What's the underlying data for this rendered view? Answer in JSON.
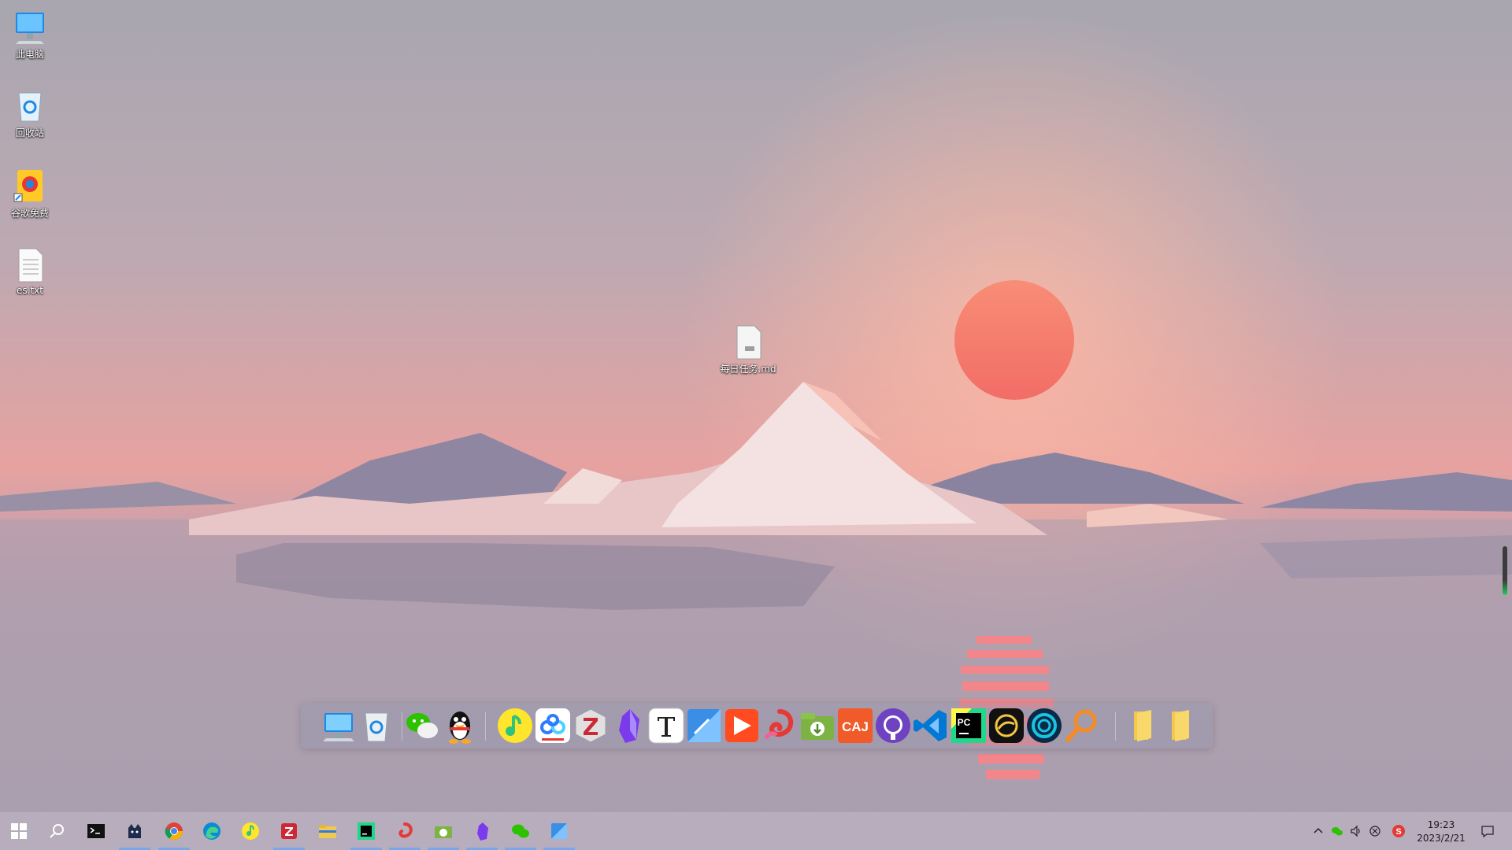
{
  "desktop": {
    "icons": [
      {
        "label": "此电脑",
        "icon": "computer-icon"
      },
      {
        "label": "回收站",
        "icon": "recycle-bin-icon"
      },
      {
        "label": "谷歌免费",
        "icon": "shortcut-icon"
      },
      {
        "label": "es.txt",
        "icon": "text-file-icon"
      },
      {
        "label": "每日任务.md",
        "icon": "markdown-file-icon"
      }
    ]
  },
  "dock": {
    "items": [
      "this-pc",
      "recycle-bin",
      "wechat",
      "qq",
      "qq-music",
      "baidu-netdisk",
      "zotero",
      "obsidian",
      "typora",
      "snipaste",
      "potplayer",
      "everything",
      "download-manager",
      "caj-viewer",
      "github-desktop",
      "vscode",
      "pycharm",
      "oracle",
      "clash",
      "search",
      "folder",
      "folder"
    ],
    "caj_label": "CAJ",
    "pycharm_label": "PC"
  },
  "taskbar": {
    "items": [
      "start",
      "search",
      "terminal",
      "clash-cat",
      "chrome",
      "edge",
      "qq-music",
      "zotero",
      "file-explorer",
      "pycharm",
      "potplayer-red",
      "download-manager",
      "obsidian",
      "wechat",
      "snipaste"
    ],
    "active": [
      "clash-cat",
      "chrome",
      "zotero",
      "pycharm",
      "potplayer-red",
      "download-manager",
      "obsidian",
      "wechat",
      "snipaste"
    ]
  },
  "tray": {
    "time": "19:23",
    "date": "2023/2/21",
    "ime_label": "S"
  },
  "colors": {
    "sky_top": "#a9a7b0",
    "sun": "#f47b6a",
    "accent": "#79a8ea"
  }
}
